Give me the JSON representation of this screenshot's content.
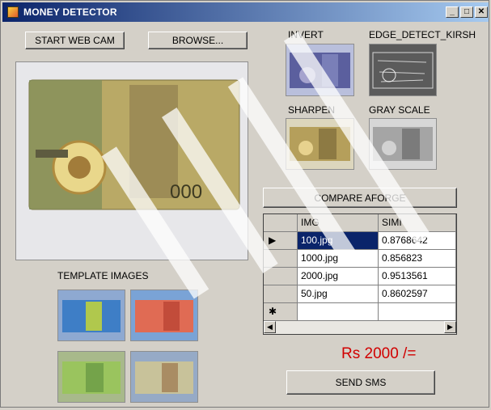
{
  "window": {
    "title": "MONEY DETECTOR"
  },
  "buttons": {
    "start_web_cam": "START WEB CAM",
    "browse": "BROWSE...",
    "compare": "COMPARE AFORGE",
    "send_sms": "SEND SMS"
  },
  "filters": {
    "invert": "INVERT",
    "edge": "EDGE_DETECT_KIRSH",
    "sharpen": "SHARPEN",
    "gray": "GRAY SCALE"
  },
  "template_label": "TEMPLATE IMAGES",
  "grid": {
    "columns": [
      "IMG",
      "SIMI"
    ],
    "rows": [
      {
        "img": "100.jpg",
        "simi": "0.8768642",
        "selected": true
      },
      {
        "img": "1000.jpg",
        "simi": "0.856823"
      },
      {
        "img": "2000.jpg",
        "simi": "0.9513561"
      },
      {
        "img": "50.jpg",
        "simi": "0.8602597"
      }
    ],
    "new_row_marker": "✱",
    "selected_marker": "▶"
  },
  "result": {
    "amount_text": "Rs 2000 /="
  },
  "colors": {
    "title_start": "#0b246a",
    "title_end": "#a6caf0",
    "accent_red": "#d10000",
    "selection": "#0a246a"
  }
}
